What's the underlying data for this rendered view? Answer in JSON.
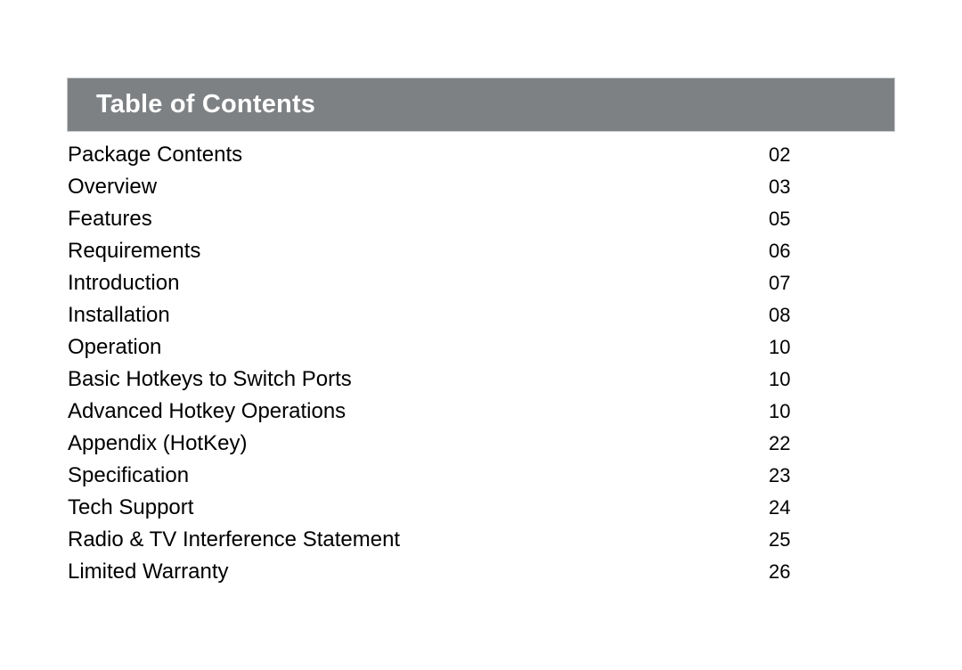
{
  "document": {
    "background_color": "#ffffff",
    "header": {
      "title": "Table of Contents",
      "background_color": "#7e8184",
      "text_color": "#ffffff",
      "border_color": "#c9cbcc"
    },
    "toc": {
      "entries": [
        {
          "label": "Package Contents",
          "page": "02"
        },
        {
          "label": "Overview",
          "page": "03"
        },
        {
          "label": "Features",
          "page": "05"
        },
        {
          "label": "Requirements",
          "page": "06"
        },
        {
          "label": "Introduction",
          "page": "07"
        },
        {
          "label": "Installation",
          "page": "08"
        },
        {
          "label": "Operation",
          "page": "10"
        },
        {
          "label": "Basic Hotkeys to Switch Ports",
          "page": "10"
        },
        {
          "label": "Advanced Hotkey Operations",
          "page": "10"
        },
        {
          "label": "Appendix (HotKey)",
          "page": "22"
        },
        {
          "label": "Specification",
          "page": "23"
        },
        {
          "label": "Tech Support",
          "page": "24"
        },
        {
          "label": "Radio & TV Interference Statement",
          "page": "25"
        },
        {
          "label": "Limited Warranty",
          "page": "26"
        }
      ]
    }
  }
}
